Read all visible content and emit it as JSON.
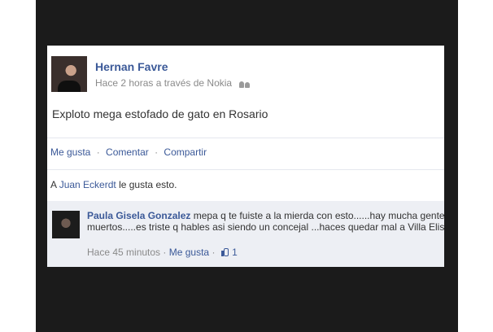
{
  "post": {
    "author": "Hernan Favre",
    "meta": "Hace 2 horas a través de Nokia",
    "privacy_icon": "people-icon",
    "text": "Exploto mega estofado de gato en Rosario"
  },
  "actions": {
    "like": "Me gusta",
    "comment": "Comentar",
    "share": "Compartir",
    "separator": "·"
  },
  "likes": {
    "prefix": "A",
    "user": "Juan Eckerdt",
    "suffix": "le gusta esto."
  },
  "comment": {
    "author": "Paula Gisela Gonzalez",
    "text": "mepa q te fuiste a la mierda con esto......hay mucha gente herida y muertos.....es triste q hables asi siendo un concejal ...haces quedar mal a Villa Elisa",
    "time": "Hace 45 minutos",
    "like_label": "Me gusta",
    "like_count": "1",
    "like_icon": "thumbs-up-icon"
  }
}
